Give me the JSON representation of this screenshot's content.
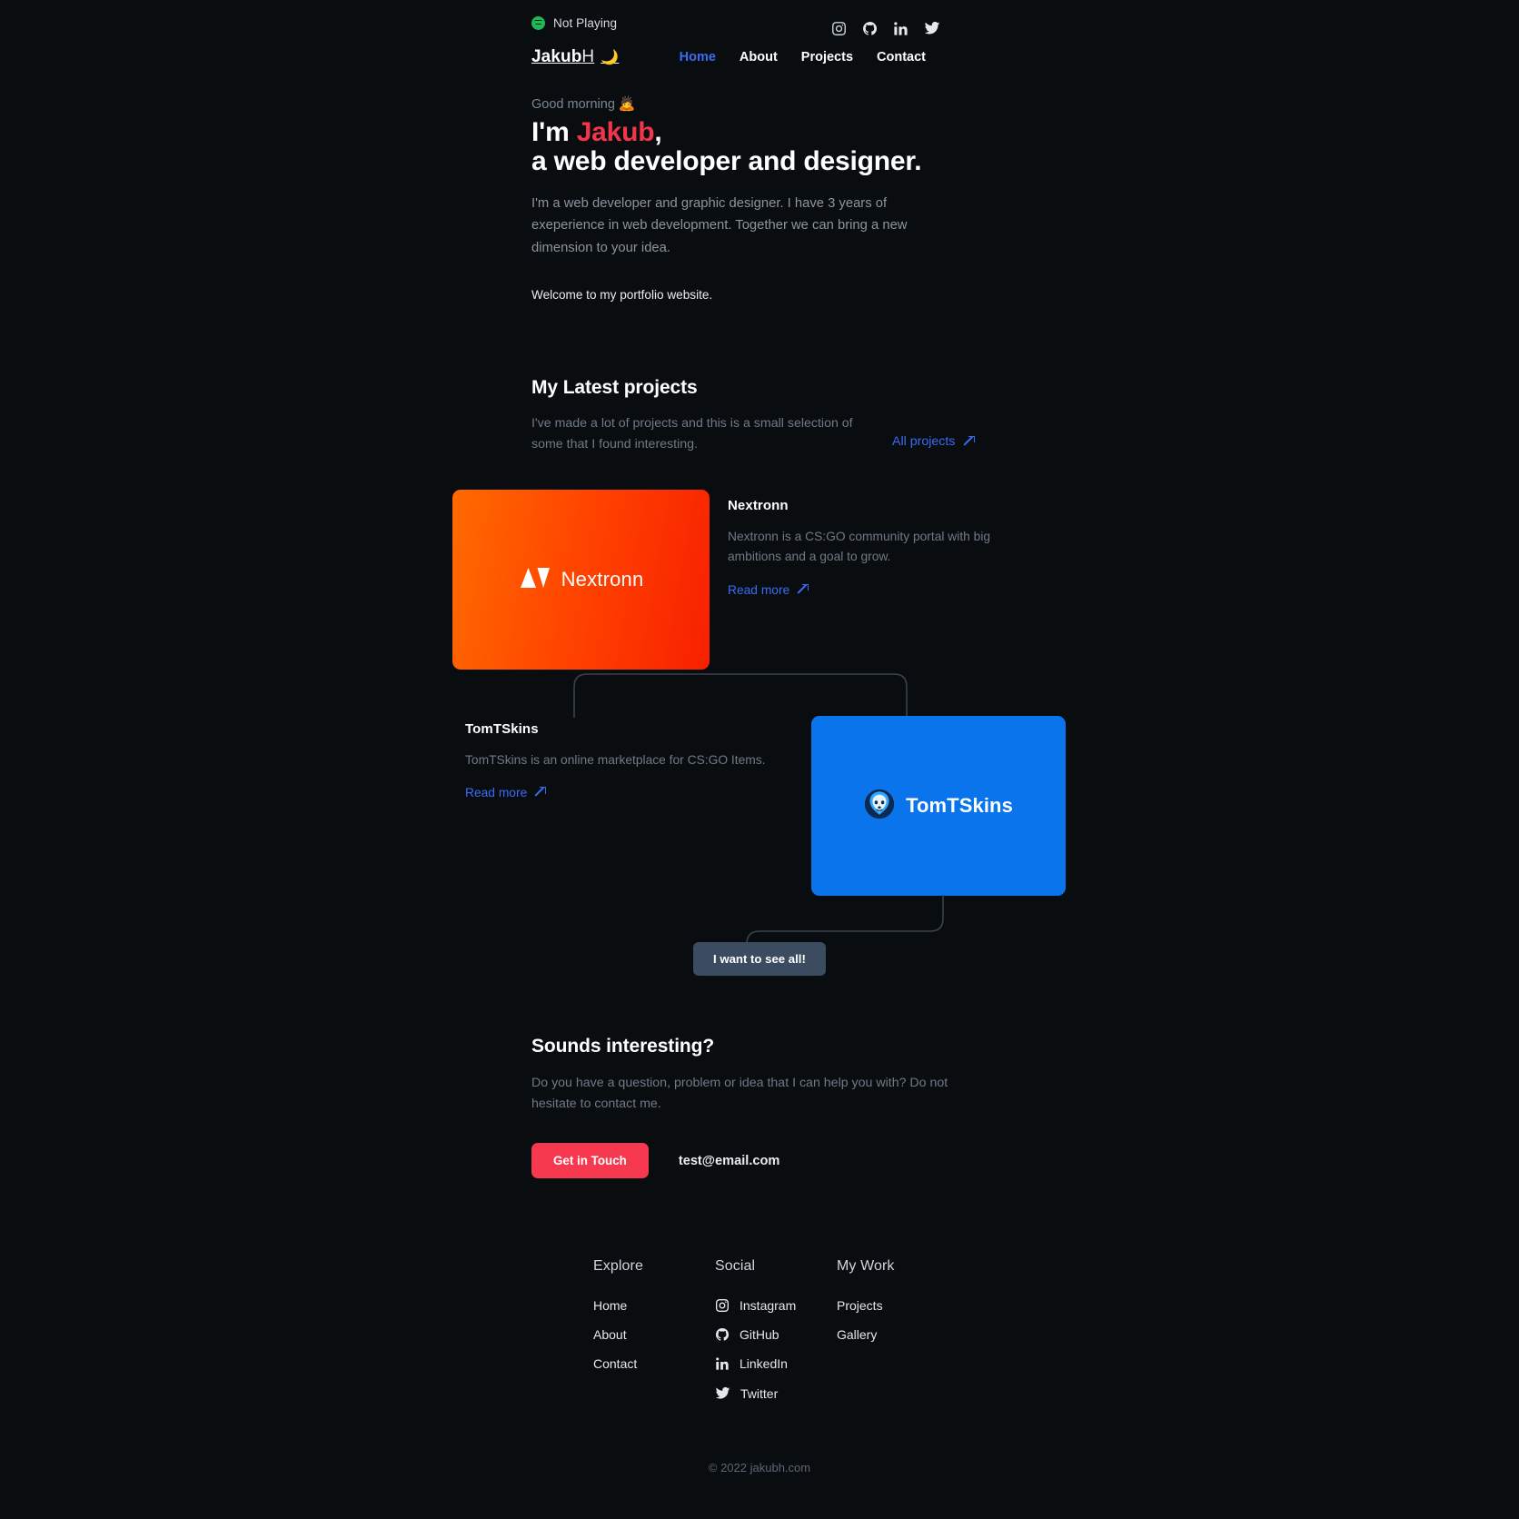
{
  "topbar": {
    "spotify_status": "Not Playing",
    "spotify_icon": "spotify-icon",
    "socials": [
      {
        "name": "instagram-icon",
        "label": "Instagram"
      },
      {
        "name": "github-icon",
        "label": "GitHub"
      },
      {
        "name": "linkedin-icon",
        "label": "LinkedIn"
      },
      {
        "name": "twitter-icon",
        "label": "Twitter"
      }
    ]
  },
  "nav": {
    "logo_bold": "Jakub",
    "logo_thin": "H",
    "theme_icon": "moon-icon",
    "theme_glyph": "🌙",
    "links": [
      {
        "label": "Home",
        "active": true
      },
      {
        "label": "About",
        "active": false
      },
      {
        "label": "Projects",
        "active": false
      },
      {
        "label": "Contact",
        "active": false
      }
    ]
  },
  "hero": {
    "greeting": "Good morning",
    "greeting_emoji": "🙇",
    "title_prefix": "I'm ",
    "title_name": "Jakub",
    "title_comma": ",",
    "title_line2": "a web developer and designer.",
    "lead": "I'm a web developer and graphic designer. I have 3 years of exeperience in web development. Together we can bring a new dimension to your idea.",
    "welcome": "Welcome to my portfolio website."
  },
  "projects": {
    "heading": "My Latest projects",
    "subtext": "I've made a lot of projects and this is a small selection of some that I found interesting.",
    "all_projects_label": "All projects",
    "see_all_button": "I want to see all!",
    "items": [
      {
        "title": "Nextronn",
        "description": "Nextronn is a CS:GO community portal with big ambitions and a goal to grow.",
        "read_more": "Read more",
        "logo_text": "Nextronn",
        "card_color_start": "#ff6a00",
        "card_color_end": "#f82000"
      },
      {
        "title": "TomTSkins",
        "description": "TomTSkins is an online marketplace for CS:GO Items.",
        "read_more": "Read more",
        "logo_text": "TomTSkins",
        "card_color": "#0a74ed"
      }
    ]
  },
  "contact": {
    "heading": "Sounds interesting?",
    "text": "Do you have a question, problem or idea that I can help you with? Do not hesitate to contact me.",
    "button_label": "Get in Touch",
    "email": "test@email.com"
  },
  "footer": {
    "columns": [
      {
        "title": "Explore",
        "links": [
          {
            "label": "Home",
            "icon": null
          },
          {
            "label": "About",
            "icon": null
          },
          {
            "label": "Contact",
            "icon": null
          }
        ]
      },
      {
        "title": "Social",
        "links": [
          {
            "label": "Instagram",
            "icon": "instagram-icon"
          },
          {
            "label": "GitHub",
            "icon": "github-icon"
          },
          {
            "label": "LinkedIn",
            "icon": "linkedin-icon"
          },
          {
            "label": "Twitter",
            "icon": "twitter-icon"
          }
        ]
      },
      {
        "title": "My Work",
        "links": [
          {
            "label": "Projects",
            "icon": null
          },
          {
            "label": "Gallery",
            "icon": null
          }
        ]
      }
    ],
    "copyright": "© 2022 jakubh.com"
  },
  "colors": {
    "background": "#0a0d10",
    "accent_blue": "#3b6bf5",
    "accent_red": "#f6394f",
    "spotify_green": "#1db954",
    "muted_text": "#6f7a87"
  }
}
